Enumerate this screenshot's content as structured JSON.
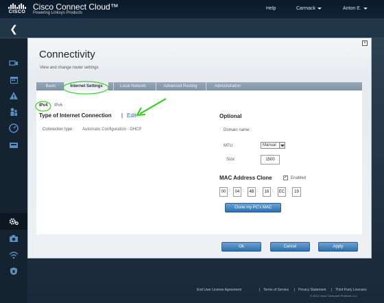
{
  "header": {
    "logo_text": "CISCO",
    "app_title": "Cisco Connect Cloud™",
    "app_subtitle": "Powering Linksys Products",
    "help": "Help",
    "router": "Carmack",
    "user": "Anton E."
  },
  "modal": {
    "title": "Connectivity",
    "subtitle": "View and change router settings",
    "close": "×",
    "tabs": [
      "Basic",
      "Internet Settings",
      "Local Network",
      "Advanced Routing",
      "Administration"
    ],
    "sub_tabs": [
      "IPv4",
      "IPv6"
    ],
    "left": {
      "heading": "Type of Internet Connection",
      "separator": "|",
      "edit": "Edit",
      "connection_label": "Connection type:",
      "connection_value": "Automatic Configuration - DHCP"
    },
    "optional": {
      "heading": "Optional",
      "domain_label": "Domain name:",
      "mtu_label": "MTU:",
      "mtu_value": "Manual",
      "size_label": "Size:",
      "size_value": "1500"
    },
    "mac_clone": {
      "heading": "MAC Address Clone",
      "enabled_label": "Enabled",
      "enabled_check": "✓",
      "octets": [
        "00",
        "04",
        "4B",
        "16",
        "EC",
        "19"
      ],
      "separator": ":",
      "clone_button": "Clone my PC's MAC"
    },
    "buttons": {
      "ok": "Ok",
      "cancel": "Cancel",
      "apply": "Apply"
    }
  },
  "footer": {
    "links": [
      "End User License Agreement",
      "Terms of Service",
      "Privacy Statement",
      "Third Party Licenses"
    ],
    "separator": "|",
    "copyright": "© 2012 Cisco Consumer Products LLC"
  },
  "colors": {
    "accent": "#2f6fa8",
    "annotation": "#3ccc2a"
  }
}
